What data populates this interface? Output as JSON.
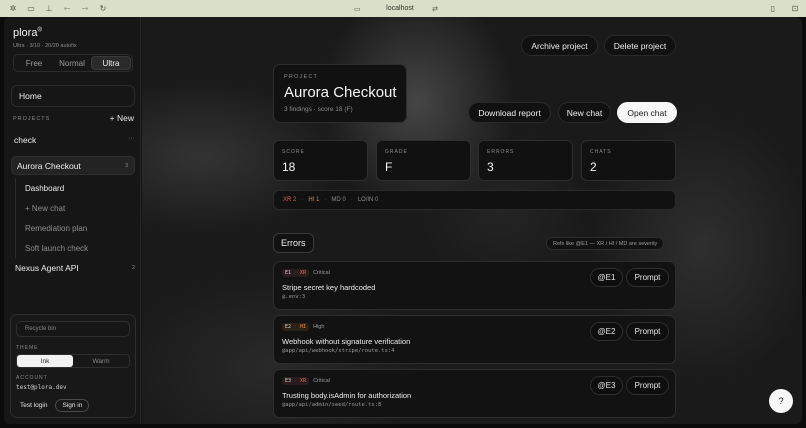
{
  "browser": {
    "url": "localhost",
    "icons": [
      "app-icon",
      "sidebar-toggle-icon",
      "shield-icon",
      "back-icon",
      "forward-icon",
      "reload-icon",
      "lock-icon",
      "tune-icon",
      "reader-icon",
      "extension-icon"
    ]
  },
  "sidebar": {
    "brand": "plora",
    "brand_mark": "®",
    "plan_meta": "Ultra · 3/10 · 20/20 autofix",
    "tiers": [
      "Free",
      "Normal",
      "Ultra"
    ],
    "active_tier": "Ultra",
    "home": "Home",
    "projects_label": "PROJECTS",
    "new_label": "+ New",
    "group": "check",
    "group_more": "···",
    "active_project": {
      "name": "Aurora Checkout",
      "count": "3"
    },
    "subnav": [
      "Dashboard",
      "+ New chat",
      "Remediation plan",
      "Soft launch check"
    ],
    "other_project": {
      "name": "Nexus Agent API",
      "count": "2"
    },
    "recycle_placeholder": "Recycle bin",
    "theme_label": "THEME",
    "theme_options": [
      "Ink",
      "Warm"
    ],
    "active_theme": "Ink",
    "account_label": "ACCOUNT",
    "account_email": "test@plora.dev",
    "test_login": "Test login",
    "sign_in": "Sign in"
  },
  "header": {
    "archive": "Archive project",
    "delete": "Delete project"
  },
  "project": {
    "kicker": "PROJECT",
    "title": "Aurora Checkout",
    "subtitle": "3 findings · score 18 (F)"
  },
  "actions": {
    "download": "Download report",
    "new_chat": "New chat",
    "open_chat": "Open chat"
  },
  "stats": [
    {
      "label": "SCORE",
      "value": "18"
    },
    {
      "label": "GRADE",
      "value": "F"
    },
    {
      "label": "ERRORS",
      "value": "3"
    },
    {
      "label": "CHATS",
      "value": "2"
    }
  ],
  "severity": {
    "xr": "XR 2",
    "hi": "HI 1",
    "md": "MD 0",
    "lo": "LO/IN 0",
    "separator": "·"
  },
  "errors_heading": "Errors",
  "refs_hint": "Refs like @E1 — XR / HI / MD are severity",
  "findings": [
    {
      "id": "E1",
      "sev": "XR",
      "level": "Critical",
      "title": "Stripe secret key hardcoded",
      "path": "@.env:3",
      "ref": "@E1",
      "prompt": "Prompt"
    },
    {
      "id": "E2",
      "sev": "HI",
      "level": "High",
      "title": "Webhook without signature verification",
      "path": "@app/api/webhook/stripe/route.ts:4",
      "ref": "@E2",
      "prompt": "Prompt"
    },
    {
      "id": "E3",
      "sev": "XR",
      "level": "Critical",
      "title": "Trusting body.isAdmin for authorization",
      "path": "@app/api/admin/seed/route.ts:8",
      "ref": "@E3",
      "prompt": "Prompt"
    }
  ],
  "help": "?",
  "colors": {
    "critical": "#e05a4f",
    "high": "#e08a4a",
    "chrome": "#d9dfc8"
  }
}
